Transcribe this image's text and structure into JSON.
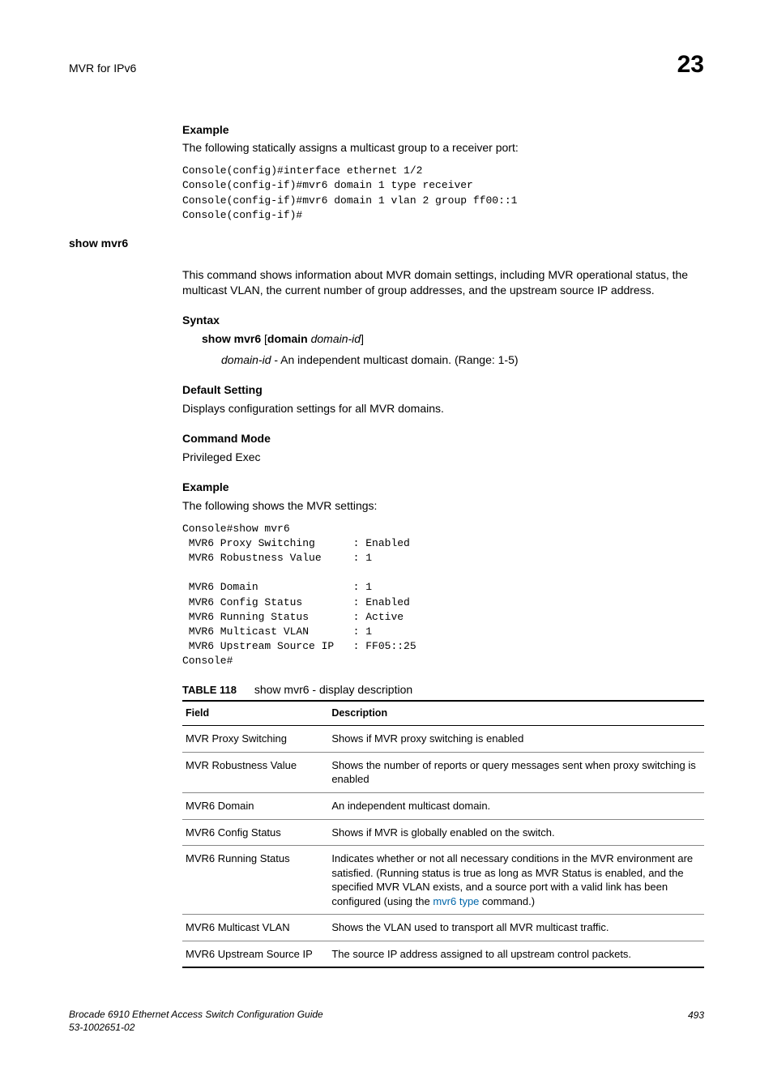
{
  "header": {
    "title": "MVR for IPv6",
    "chapter": "23"
  },
  "sec1": {
    "heading": "Example",
    "intro": "The following statically assigns a multicast group to a receiver port:",
    "code": "Console(config)#interface ethernet 1/2\nConsole(config-if)#mvr6 domain 1 type receiver\nConsole(config-if)#mvr6 domain 1 vlan 2 group ff00::1\nConsole(config-if)#"
  },
  "cmd": {
    "name": "show mvr6",
    "desc": "This command shows information about MVR domain settings, including MVR operational status, the multicast VLAN, the current number of group addresses, and the upstream source IP address."
  },
  "syntax": {
    "heading": "Syntax",
    "cmd_b1": "show mvr6",
    "cmd_plain1": " [",
    "cmd_b2": "domain",
    "cmd_plain2": " ",
    "cmd_i": "domain-id",
    "cmd_plain3": "]",
    "arg_i": "domain-id",
    "arg_desc": " - An independent multicast domain. (Range: 1-5)"
  },
  "default": {
    "heading": "Default Setting",
    "text": "Displays configuration settings for all MVR domains."
  },
  "mode": {
    "heading": "Command Mode",
    "text": "Privileged Exec"
  },
  "example2": {
    "heading": "Example",
    "intro": "The following shows the MVR settings:",
    "code": "Console#show mvr6\n MVR6 Proxy Switching      : Enabled\n MVR6 Robustness Value     : 1\n\n MVR6 Domain               : 1\n MVR6 Config Status        : Enabled\n MVR6 Running Status       : Active\n MVR6 Multicast VLAN       : 1\n MVR6 Upstream Source IP   : FF05::25\nConsole#"
  },
  "table": {
    "label": "TABLE 118",
    "title": "show mvr6 - display description",
    "col1": "Field",
    "col2": "Description",
    "rows": [
      {
        "f": "MVR Proxy Switching",
        "d": "Shows if MVR proxy switching is enabled"
      },
      {
        "f": "MVR Robustness Value",
        "d": "Shows the number of reports or query messages sent when proxy switching is enabled"
      },
      {
        "f": "MVR6 Domain",
        "d": "An independent multicast domain."
      },
      {
        "f": "MVR6 Config Status",
        "d": "Shows if MVR is globally enabled on the switch."
      },
      {
        "f": "MVR6 Running Status",
        "d_pre": "Indicates whether or not all necessary conditions in the MVR environment are satisfied. (Running status is true as long as MVR Status is enabled, and the specified MVR VLAN exists, and a source port with a valid link has been configured (using the ",
        "d_link": "mvr6 type",
        "d_post": " command.)"
      },
      {
        "f": "MVR6 Multicast VLAN",
        "d": "Shows the VLAN used to transport all MVR multicast traffic."
      },
      {
        "f": "MVR6 Upstream Source IP",
        "d": "The source IP address assigned to all upstream control packets."
      }
    ]
  },
  "footer": {
    "line1": "Brocade 6910 Ethernet Access Switch Configuration Guide",
    "line2": "53-1002651-02",
    "page": "493"
  }
}
